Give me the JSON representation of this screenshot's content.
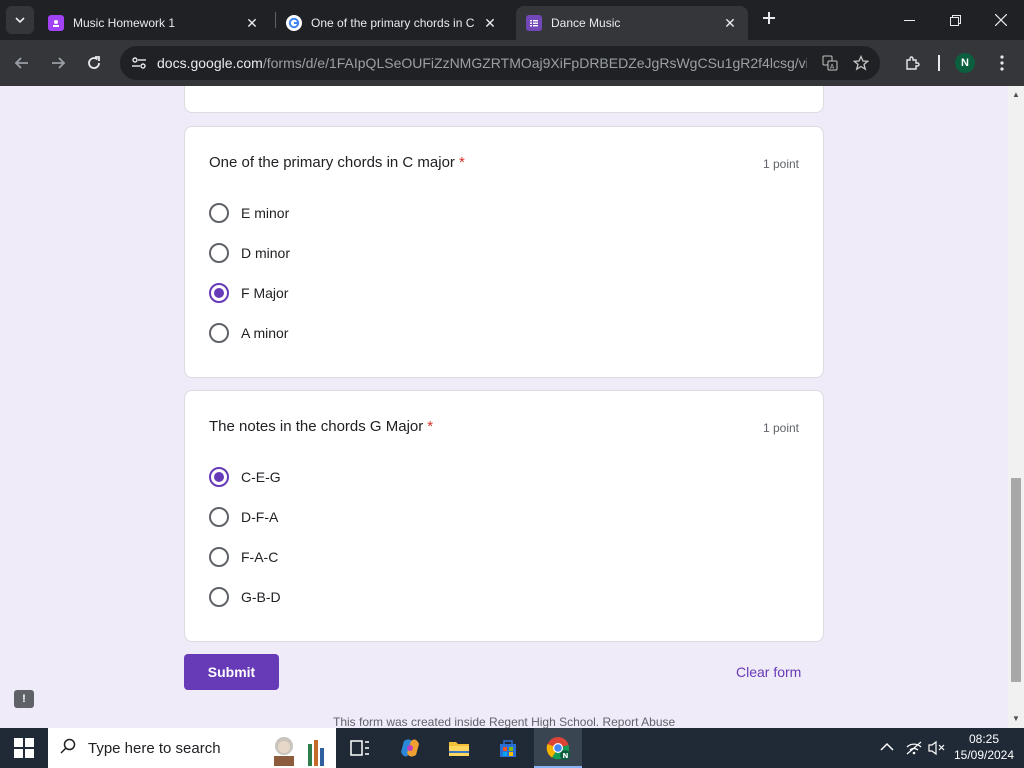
{
  "browser": {
    "tabs": [
      {
        "title": "Music Homework 1",
        "favicon": "classroom-icon",
        "active": false
      },
      {
        "title": "One of the primary chords in C",
        "favicon": "google-icon",
        "active": false
      },
      {
        "title": "Dance Music",
        "favicon": "forms-icon",
        "active": true
      }
    ],
    "url_host": "docs.google.com",
    "url_path": "/forms/d/e/1FAIpQLSeOUFiZzNMGZRTMOaj9XiFpDRBEDZeJgRsWgCSu1gR2f4lcsg/viewf...",
    "profile_initial": "N"
  },
  "form": {
    "questions": [
      {
        "title": "One of the primary chords in C major",
        "required_mark": "*",
        "points": "1 point",
        "options": [
          {
            "label": "E minor",
            "selected": false
          },
          {
            "label": "D minor",
            "selected": false
          },
          {
            "label": "F Major",
            "selected": true
          },
          {
            "label": "A minor",
            "selected": false
          }
        ]
      },
      {
        "title": "The notes in the chords G Major",
        "required_mark": "*",
        "points": "1 point",
        "options": [
          {
            "label": "C-E-G",
            "selected": true
          },
          {
            "label": "D-F-A",
            "selected": false
          },
          {
            "label": "F-A-C",
            "selected": false
          },
          {
            "label": "G-B-D",
            "selected": false
          }
        ]
      }
    ],
    "submit_label": "Submit",
    "clear_label": "Clear form",
    "footer_note": "This form was created inside Regent High School. Report Abuse",
    "accent_color": "#673ab7"
  },
  "taskbar": {
    "search_placeholder": "Type here to search",
    "time": "08:25",
    "date": "15/09/2024"
  }
}
